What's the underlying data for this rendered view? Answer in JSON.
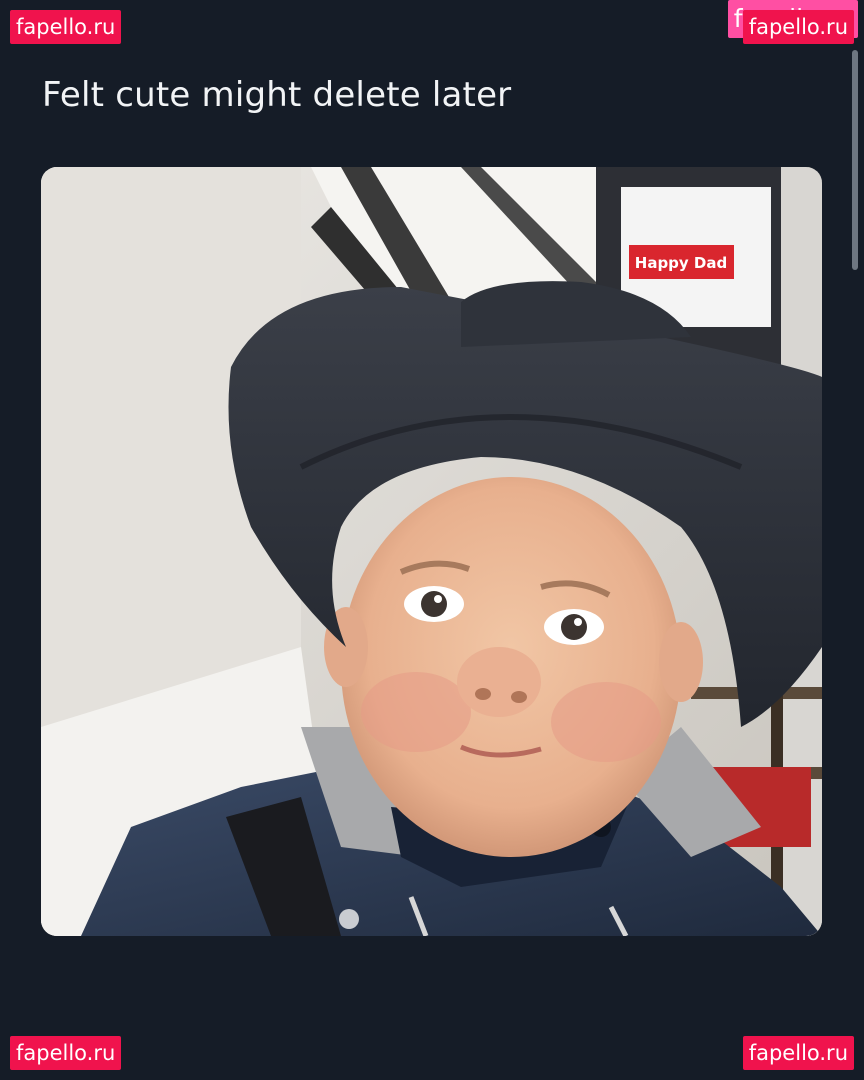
{
  "post": {
    "text": "Felt cute might delete later"
  },
  "media": {
    "sign_text": "Happy Dad"
  },
  "watermarks": {
    "top_left": "fapello.ru",
    "top_right_back": "fapello.ru",
    "top_right": "fapello.ru",
    "bottom_left": "fapello.ru",
    "bottom_right": "fapello.ru"
  },
  "colors": {
    "background": "#151c27",
    "text": "#f2f4f6",
    "watermark": "#f0134d",
    "watermark_alt": "#ff4fa3"
  }
}
